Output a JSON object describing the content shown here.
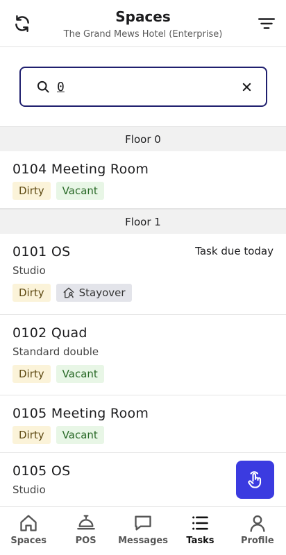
{
  "header": {
    "title": "Spaces",
    "subtitle": "The Grand Mews Hotel (Enterprise)"
  },
  "search": {
    "value": "0"
  },
  "floors": [
    {
      "label": "Floor 0",
      "rooms": [
        {
          "name": "0104 Meeting Room",
          "type": "",
          "task": "",
          "tags": [
            "Dirty",
            "Vacant"
          ]
        }
      ]
    },
    {
      "label": "Floor 1",
      "rooms": [
        {
          "name": "0101 OS",
          "type": "Studio",
          "task": "Task due today",
          "tags": [
            "Dirty",
            "Stayover"
          ]
        },
        {
          "name": "0102 Quad",
          "type": "Standard double",
          "task": "",
          "tags": [
            "Dirty",
            "Vacant"
          ]
        },
        {
          "name": "0105 Meeting Room",
          "type": "",
          "task": "",
          "tags": [
            "Dirty",
            "Vacant"
          ]
        },
        {
          "name": "0105 OS",
          "type": "Studio",
          "task": "",
          "tags": []
        }
      ]
    }
  ],
  "nav": [
    {
      "label": "Spaces",
      "icon": "home-icon",
      "active": false
    },
    {
      "label": "POS",
      "icon": "service-bell-icon",
      "active": false
    },
    {
      "label": "Messages",
      "icon": "chat-bubble-icon",
      "active": false
    },
    {
      "label": "Tasks",
      "icon": "task-list-icon",
      "active": true
    },
    {
      "label": "Profile",
      "icon": "person-icon",
      "active": false
    }
  ],
  "colors": {
    "accent": "#3b3be0",
    "search_border": "#1f1f6e",
    "dirty_bg": "#fbf3d9",
    "vacant_bg": "#e8f6e6",
    "stayover_bg": "#e3e4ea"
  }
}
